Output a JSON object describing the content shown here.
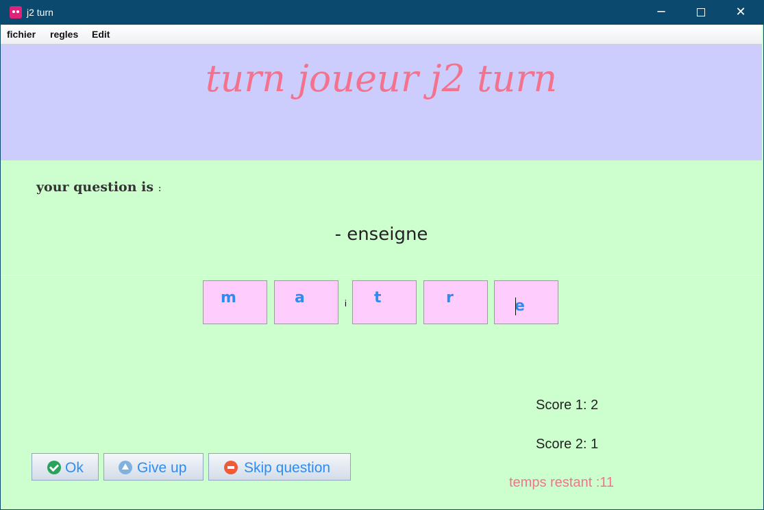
{
  "window": {
    "title": "j2 turn"
  },
  "menu": [
    "fichier",
    "regles",
    "Edit"
  ],
  "header": {
    "title": "turn joueur j2 turn"
  },
  "question": {
    "label": "your question is",
    "colon": ":",
    "text": "- enseigne"
  },
  "answer": {
    "letters": [
      "m",
      "a",
      "t",
      "r",
      "e"
    ],
    "fixed_letter": "i"
  },
  "scores": {
    "score1": "Score 1: 2",
    "score2": "Score 2: 1"
  },
  "timer": "temps restant :11",
  "buttons": {
    "ok": "Ok",
    "give_up": "Give up",
    "skip": "Skip question"
  },
  "colors": {
    "header_bg": "#cccdfd",
    "body_bg": "#cdfecd",
    "title": "#f3738e",
    "letter_box": "#ffccfe",
    "button_text": "#2d8cf0",
    "titlebar": "#0b4a6e"
  }
}
